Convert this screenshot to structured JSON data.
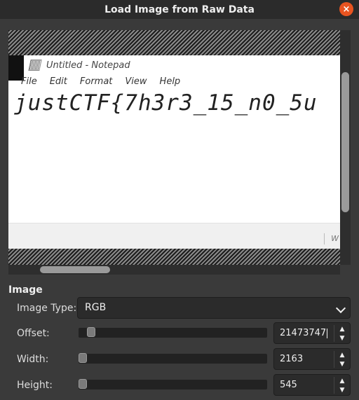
{
  "window": {
    "title": "Load Image from Raw Data",
    "close_icon": "×"
  },
  "preview": {
    "notepad_title": "Untitled - Notepad",
    "menu": [
      "File",
      "Edit",
      "Format",
      "View",
      "Help"
    ],
    "content_text": "justCTF{7h3r3_15_n0_5u",
    "status_fragment": "W"
  },
  "section": {
    "label": "Image"
  },
  "image_type": {
    "label": "Image Type:",
    "value": "RGB"
  },
  "offset": {
    "label": "Offset:",
    "value": "21473747"
  },
  "width": {
    "label": "Width:",
    "value": "2163"
  },
  "height": {
    "label": "Height:",
    "value": "545"
  },
  "spinner": {
    "up_icon": "▲",
    "down_icon": "▼"
  }
}
